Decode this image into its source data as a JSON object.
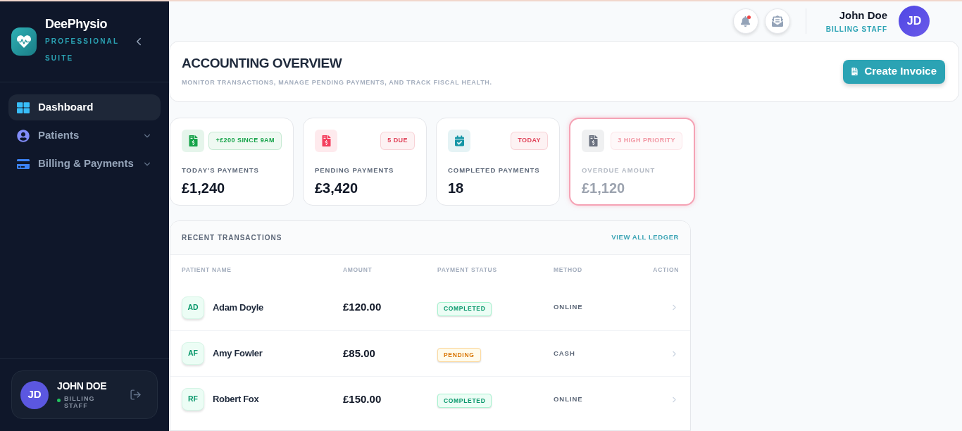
{
  "sidebar": {
    "brand": {
      "name": "DeePhysio",
      "tagline": "PROFESSIONAL SUITE"
    },
    "nav": [
      {
        "label": "Dashboard",
        "kind": "grid",
        "selected": true,
        "submenu": false
      },
      {
        "label": "Patients",
        "kind": "user",
        "selected": false,
        "submenu": true
      },
      {
        "label": "Billing & Payments",
        "kind": "card",
        "selected": false,
        "submenu": true
      }
    ],
    "user": {
      "initials": "JD",
      "name": "JOHN DOE",
      "role": "BILLING STAFF",
      "online": true
    }
  },
  "header": {
    "notifications": {
      "unread": true
    },
    "user": {
      "name": "John Doe",
      "role": "BILLING STAFF",
      "initials": "JD"
    }
  },
  "overview": {
    "title": "ACCOUNTING OVERVIEW",
    "subtitle": "MONITOR TRANSACTIONS, MANAGE PENDING PAYMENTS, AND TRACK FISCAL HEALTH.",
    "button": "Create Invoice"
  },
  "stats": [
    {
      "kind": "invoice",
      "color": "#16a34a",
      "badge": {
        "text": "+£200 SINCE 9AM",
        "color": "#16a34a"
      },
      "label": "TODAY'S PAYMENTS",
      "value": "£1,240",
      "flagged": false
    },
    {
      "kind": "invoice",
      "color": "#f43f5e",
      "badge": {
        "text": "5 DUE",
        "color": "#e0445a"
      },
      "label": "PENDING PAYMENTS",
      "value": "£3,420",
      "flagged": false
    },
    {
      "kind": "calendar",
      "color": "#1596a6",
      "badge": {
        "text": "TODAY",
        "color": "#e0445a"
      },
      "label": "COMPLETED PAYMENTS",
      "value": "18",
      "flagged": false
    },
    {
      "kind": "invoice",
      "color": "#6b7280",
      "badge": {
        "text": "3 HIGH PRIORITY",
        "color": "#f29aa6"
      },
      "label": "OVERDUE AMOUNT",
      "value": "£1,120",
      "flagged": true
    }
  ],
  "transactions": {
    "title": "RECENT TRANSACTIONS",
    "link": "VIEW ALL LEDGER",
    "columns": [
      "PATIENT NAME",
      "AMOUNT",
      "PAYMENT STATUS",
      "METHOD",
      "ACTION"
    ],
    "rows": [
      {
        "initials": "AD",
        "name": "Adam Doyle",
        "amount": "£120.00",
        "status": {
          "label": "COMPLETED",
          "kind": "completed"
        },
        "method": "ONLINE"
      },
      {
        "initials": "AF",
        "name": "Amy Fowler",
        "amount": "£85.00",
        "status": {
          "label": "PENDING",
          "kind": "pending"
        },
        "method": "CASH"
      },
      {
        "initials": "RF",
        "name": "Robert Fox",
        "amount": "£150.00",
        "status": {
          "label": "COMPLETED",
          "kind": "completed"
        },
        "method": "ONLINE"
      }
    ]
  }
}
